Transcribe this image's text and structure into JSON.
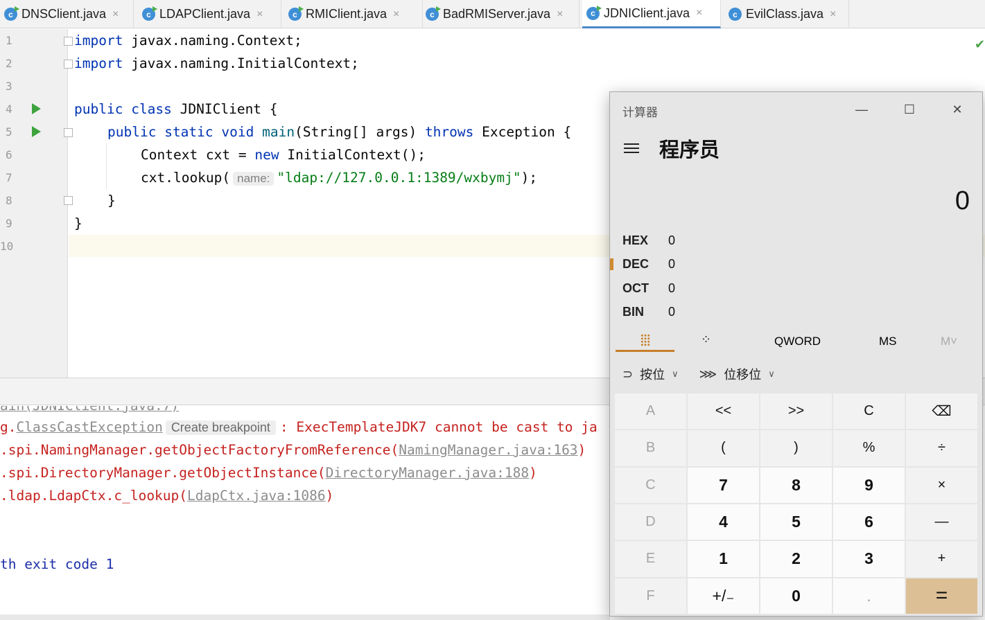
{
  "tabs": [
    {
      "label": "DNSClient.java",
      "close": "×",
      "run_badge": true
    },
    {
      "label": "LDAPClient.java",
      "close": "×",
      "run_badge": true
    },
    {
      "label": "RMIClient.java",
      "close": "×",
      "run_badge": true
    },
    {
      "label": "BadRMIServer.java",
      "close": "×",
      "run_badge": true
    },
    {
      "label": "JDNIClient.java",
      "close": "×",
      "run_badge": true,
      "active": true
    },
    {
      "label": "EvilClass.java",
      "close": "×",
      "run_badge": false
    }
  ],
  "editor": {
    "line_numbers": [
      "1",
      "2",
      "3",
      "4",
      "5",
      "6",
      "7",
      "8",
      "9",
      "10"
    ],
    "current_line": 10,
    "code": {
      "l1_kw": "import",
      "l1_rest": " javax.naming.Context;",
      "l2_kw": "import",
      "l2_rest": " javax.naming.InitialContext;",
      "l4_kw1": "public",
      "l4_kw2": "class",
      "l4_rest": " JDNIClient {",
      "l5_kw1": "public",
      "l5_kw2": "static",
      "l5_kw3": "void",
      "l5_fn": "main",
      "l5_mid": "(String[] args) ",
      "l5_kw4": "throws",
      "l5_rest": " Exception {",
      "l6_pre": "Context cxt = ",
      "l6_kw": "new",
      "l6_rest": " InitialContext();",
      "l7_pre": "cxt.lookup(",
      "l7_hint": "name:",
      "l7_str": "\"ldap://127.0.0.1:1389/wxbymj\"",
      "l7_rest": ");",
      "l8": "}",
      "l9": "}"
    }
  },
  "console": {
    "top_partial": "ain(JDNIClient.java:7)",
    "l1_pre": "g.",
    "l1_link": "ClassCastException",
    "l1_hint": "Create breakpoint",
    "l1_rest": ": ExecTemplateJDK7 cannot be cast to ja",
    "l2_pre": ".spi.NamingManager.getObjectFactoryFromReference(",
    "l2_link": "NamingManager.java:163",
    "l2_post": ")",
    "l3_pre": ".spi.DirectoryManager.getObjectInstance(",
    "l3_link": "DirectoryManager.java:188",
    "l3_post": ")",
    "l4_pre": ".ldap.LdapCtx.c_lookup(",
    "l4_link": "LdapCtx.java:1086",
    "l4_post": ")",
    "exit": "th exit code 1"
  },
  "calculator": {
    "window_title": "计算器",
    "mode": "程序员",
    "display": "0",
    "radix": [
      {
        "name": "HEX",
        "value": "0"
      },
      {
        "name": "DEC",
        "value": "0",
        "selected": true
      },
      {
        "name": "OCT",
        "value": "0"
      },
      {
        "name": "BIN",
        "value": "0"
      }
    ],
    "word_size": "QWORD",
    "ms": "MS",
    "mv": "M˅",
    "bitwise": "按位",
    "bitshift": "位移位",
    "keys": [
      [
        "A",
        "<<",
        ">>",
        "C",
        "⌫"
      ],
      [
        "B",
        "(",
        ")",
        "%",
        "÷"
      ],
      [
        "C",
        "7",
        "8",
        "9",
        "×"
      ],
      [
        "D",
        "4",
        "5",
        "6",
        "—"
      ],
      [
        "E",
        "1",
        "2",
        "3",
        "+"
      ],
      [
        "F",
        "+/₋",
        "0",
        ".",
        "="
      ]
    ]
  }
}
